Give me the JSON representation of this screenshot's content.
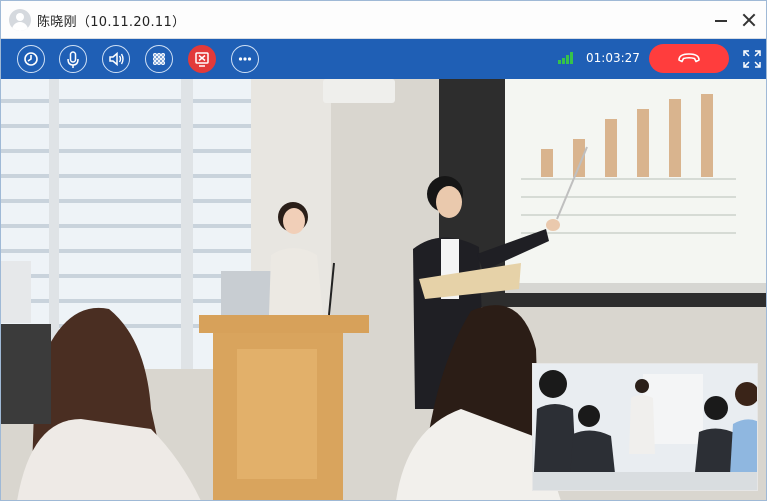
{
  "window": {
    "title": "陈晓刚（10.11.20.11）"
  },
  "toolbar": {
    "call_timer": "01:03:27",
    "buttons": [
      {
        "icon": "record-icon"
      },
      {
        "icon": "microphone-icon"
      },
      {
        "icon": "speaker-icon"
      },
      {
        "icon": "dialpad-icon"
      },
      {
        "icon": "stop-share-icon"
      },
      {
        "icon": "more-icon"
      }
    ],
    "signal_strength": "4 of 4 bars",
    "hangup_icon": "hang-up-icon",
    "fullscreen_icon": "fullscreen-icon"
  },
  "colors": {
    "toolbar_bg": "#1f5fb5",
    "hangup": "#ff3d3d",
    "stop_share": "#e23a3a",
    "signal": "#36c24a"
  },
  "main_video": {
    "content": "classroom presentation scene"
  },
  "self_view": {
    "content": "small picture-in-picture video"
  }
}
